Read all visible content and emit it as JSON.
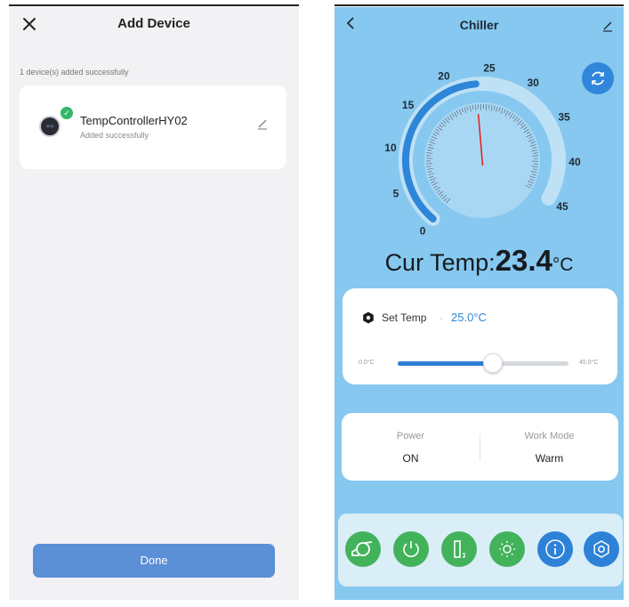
{
  "left": {
    "title": "Add Device",
    "close_icon": "close-icon",
    "message": "1 device(s) added successfully",
    "device": {
      "name": "TempControllerHY02",
      "status": "Added successfully",
      "thumb_text": "20.5",
      "edit_icon": "pencil-icon",
      "badge_icon": "check-icon"
    },
    "done_label": "Done"
  },
  "right": {
    "title": "Chiller",
    "back_icon": "chevron-left-icon",
    "edit_icon": "pencil-icon",
    "refresh_icon": "refresh-icon",
    "gauge": {
      "ticks": [
        "0",
        "5",
        "10",
        "15",
        "20",
        "25",
        "30",
        "35",
        "40",
        "45"
      ],
      "min": 0,
      "max": 45,
      "value": 23.4,
      "active_value": 23.4
    },
    "cur_temp_label": "Cur Temp:",
    "cur_temp_value": "23.4",
    "cur_temp_unit": "°C",
    "set_temp": {
      "label": "Set Temp",
      "separator": "·",
      "value": "25.0°C",
      "min_label": "0.0°C",
      "max_label": "45.0°C",
      "min": 0,
      "max": 45,
      "current": 25
    },
    "status": {
      "power_label": "Power",
      "power_value": "ON",
      "mode_label": "Work Mode",
      "mode_value": "Warm"
    },
    "controls": [
      {
        "name": "pump-icon",
        "color": "#43b35b"
      },
      {
        "name": "power-icon",
        "color": "#43b35b"
      },
      {
        "name": "device-icon",
        "color": "#43b35b"
      },
      {
        "name": "sun-icon",
        "color": "#43b35b"
      },
      {
        "name": "info-icon",
        "color": "#2d82d8"
      },
      {
        "name": "gear-icon",
        "color": "#2d82d8"
      }
    ]
  },
  "colors": {
    "primary_blue": "#2e86d8",
    "green": "#43b35b",
    "panel_blue": "#86c8ef",
    "done_button": "#5b8fd6"
  }
}
